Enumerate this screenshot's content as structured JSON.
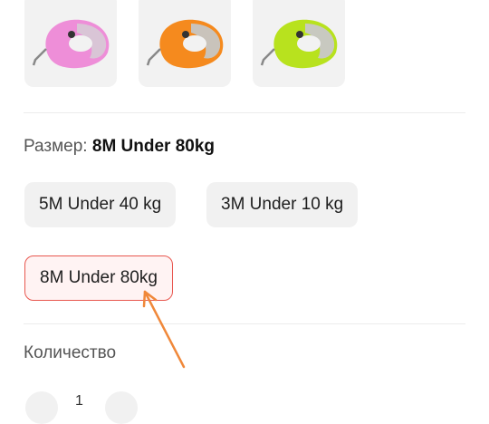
{
  "variants": [
    {
      "name": "pink",
      "color": "#ee8ed8",
      "accent": "#d9c5d6"
    },
    {
      "name": "orange",
      "color": "#f58a1e",
      "accent": "#c9c3bb"
    },
    {
      "name": "lime",
      "color": "#b8e21e",
      "accent": "#c8c9c0"
    }
  ],
  "size": {
    "label": "Размер:",
    "selected_value": "8M Under 80kg",
    "options": [
      "5M Under 40 kg",
      "3M Under 10 kg",
      "8M Under 80kg"
    ]
  },
  "quantity": {
    "label": "Количество",
    "value": "1"
  },
  "annotation": {
    "color": "#f0883a"
  }
}
